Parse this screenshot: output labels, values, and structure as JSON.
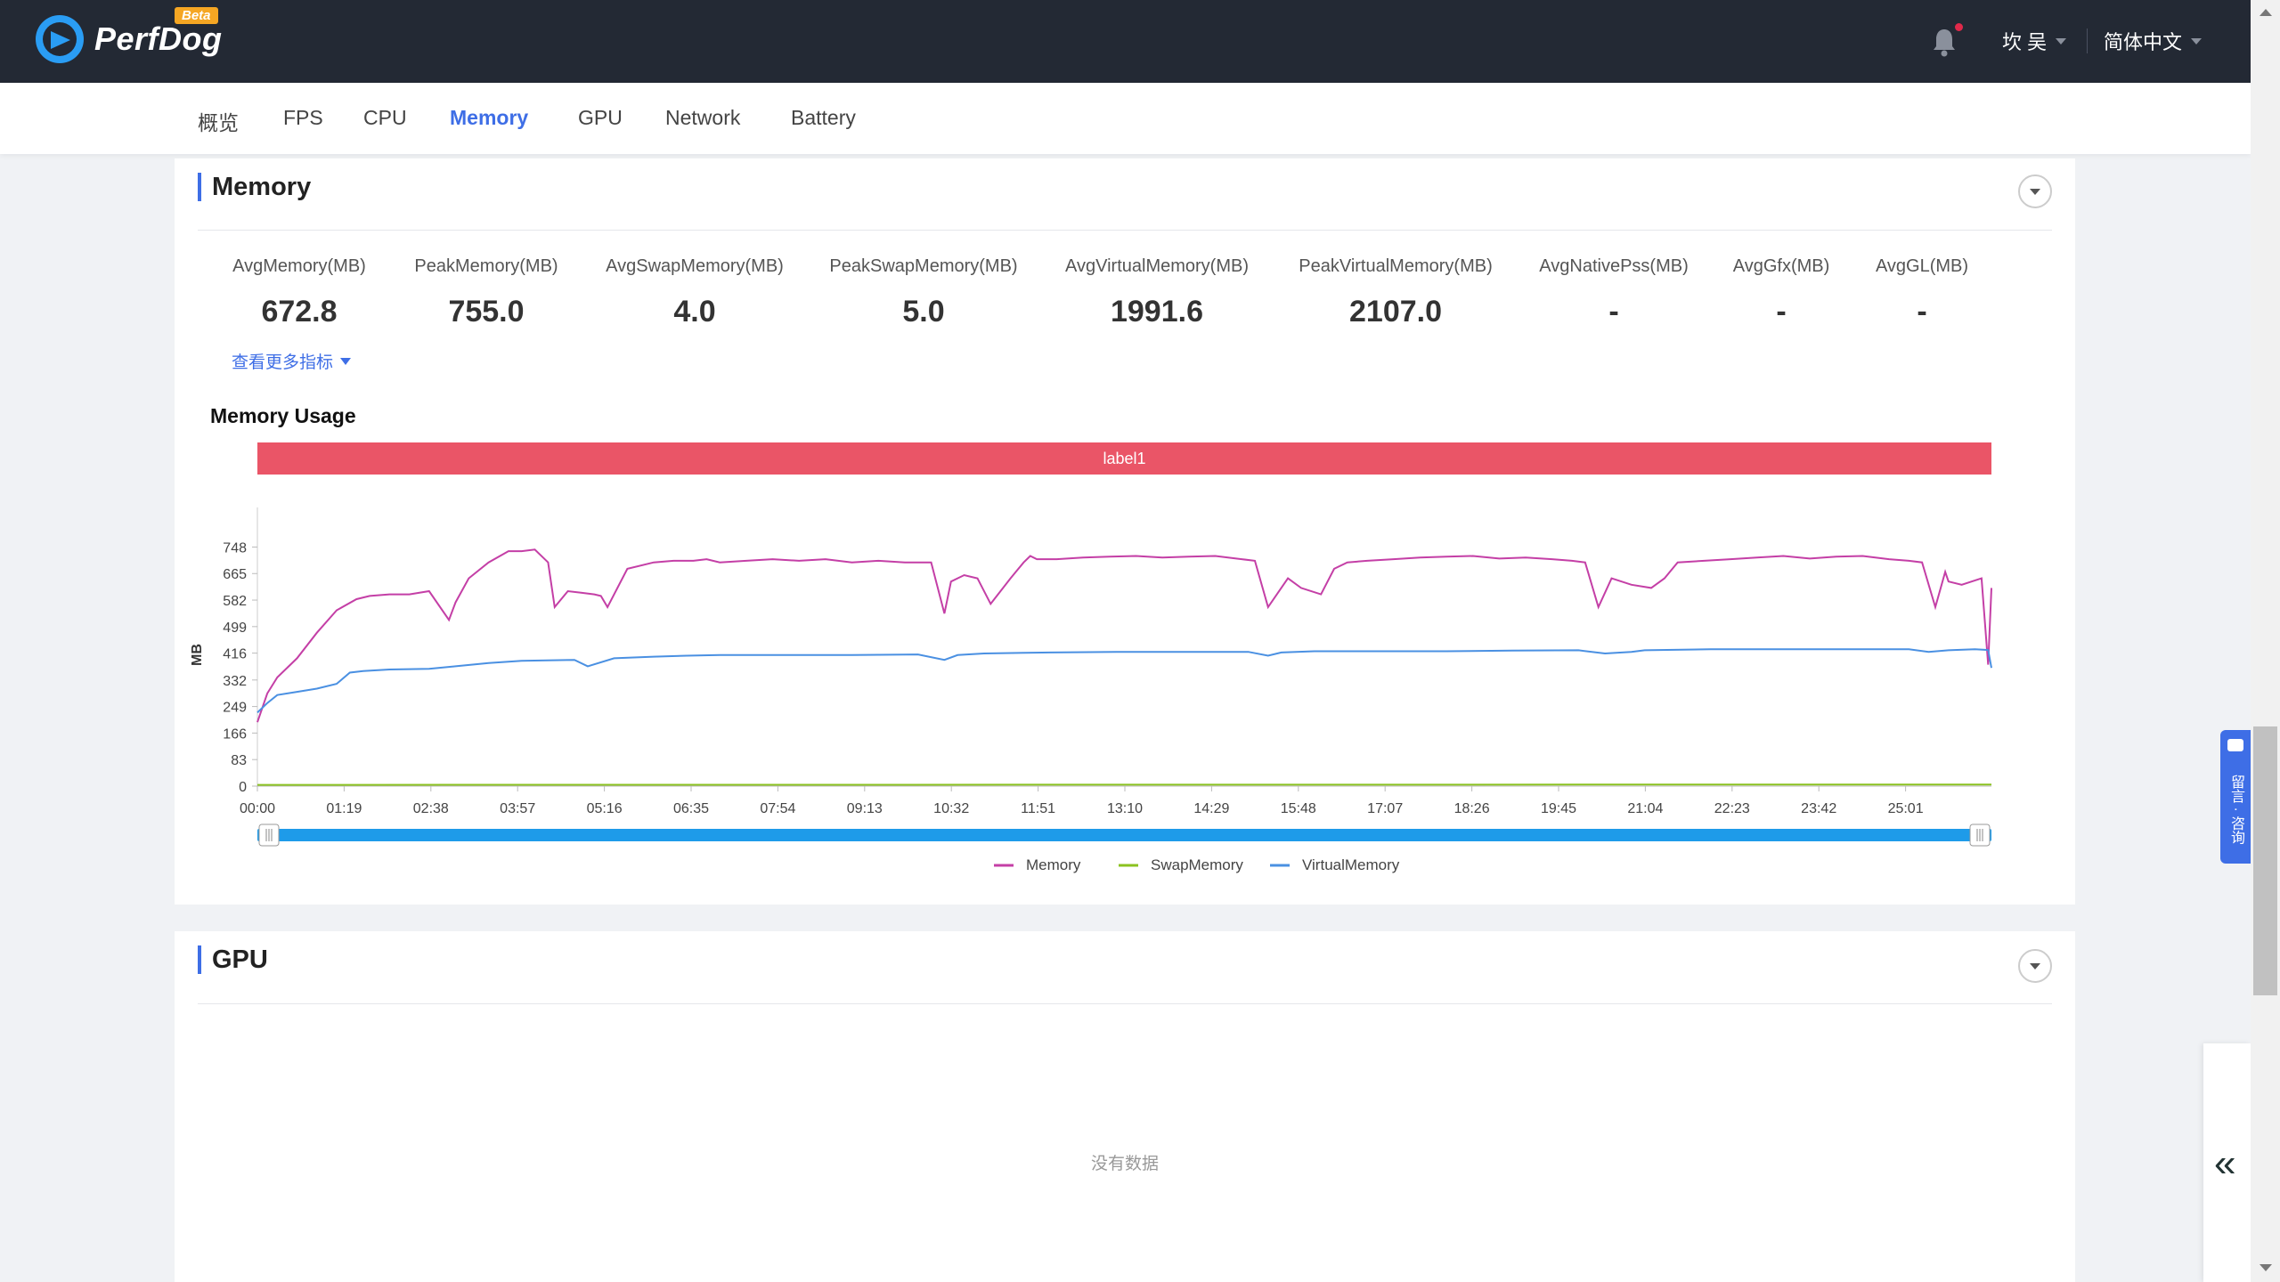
{
  "header": {
    "brand": "PerfDog",
    "badge": "Beta",
    "user": "坎 吴",
    "language": "简体中文"
  },
  "tabs": [
    {
      "label": "概览"
    },
    {
      "label": "FPS"
    },
    {
      "label": "CPU"
    },
    {
      "label": "Memory",
      "active": true
    },
    {
      "label": "GPU"
    },
    {
      "label": "Network"
    },
    {
      "label": "Battery"
    }
  ],
  "memory_panel": {
    "title": "Memory",
    "metrics": [
      {
        "label": "AvgMemory(MB)",
        "value": "672.8"
      },
      {
        "label": "PeakMemory(MB)",
        "value": "755.0"
      },
      {
        "label": "AvgSwapMemory(MB)",
        "value": "4.0"
      },
      {
        "label": "PeakSwapMemory(MB)",
        "value": "5.0"
      },
      {
        "label": "AvgVirtualMemory(MB)",
        "value": "1991.6"
      },
      {
        "label": "PeakVirtualMemory(MB)",
        "value": "2107.0"
      },
      {
        "label": "AvgNativePss(MB)",
        "value": "-"
      },
      {
        "label": "AvgGfx(MB)",
        "value": "-"
      },
      {
        "label": "AvgGL(MB)",
        "value": "-"
      }
    ],
    "more_metrics_link": "查看更多指标",
    "chart_title": "Memory Usage"
  },
  "gpu_panel": {
    "title": "GPU",
    "empty_text": "没有数据"
  },
  "feedback_tab": "留言 · 咨询",
  "colors": {
    "accent": "#3e6ee6",
    "memory": "#c43fa6",
    "swap": "#8bc220",
    "virtual": "#4a90e2",
    "label_band": "#ea5567",
    "slider": "#1e9be9"
  },
  "chart_data": {
    "type": "line",
    "ylabel": "MB",
    "yticks": [
      0,
      83,
      166,
      249,
      332,
      416,
      499,
      582,
      665,
      748
    ],
    "ylim": [
      0,
      830
    ],
    "xticks": [
      "00:00",
      "01:19",
      "02:38",
      "03:57",
      "05:16",
      "06:35",
      "07:54",
      "09:13",
      "10:32",
      "11:51",
      "13:10",
      "14:29",
      "15:48",
      "17:07",
      "18:26",
      "19:45",
      "21:04",
      "22:23",
      "23:42",
      "25:01"
    ],
    "label_band": "label1",
    "series": [
      {
        "name": "Memory",
        "x_min": [
          0,
          0.15,
          0.3,
          0.6,
          0.9,
          1.2,
          1.5,
          1.7,
          2.0,
          2.3,
          2.6,
          2.9,
          3.0,
          3.2,
          3.5,
          3.8,
          3.9,
          4.0,
          4.2,
          4.4,
          4.5,
          4.7,
          4.9,
          5.1,
          5.2,
          5.3,
          5.6,
          6.0,
          6.3,
          6.6,
          6.8,
          7.0,
          7.4,
          7.8,
          8.2,
          8.6,
          9.0,
          9.4,
          9.8,
          10.2,
          10.4,
          10.5,
          10.7,
          10.9,
          11.1,
          11.4,
          11.6,
          11.7,
          11.8,
          12.1,
          12.5,
          12.9,
          13.3,
          13.7,
          14.1,
          14.5,
          14.9,
          15.1,
          15.3,
          15.6,
          15.8,
          16.1,
          16.3,
          16.5,
          16.8,
          17.2,
          17.6,
          18.0,
          18.4,
          18.8,
          19.2,
          19.6,
          19.9,
          20.1,
          20.3,
          20.5,
          20.8,
          21.1,
          21.3,
          21.5,
          21.9,
          22.3,
          22.7,
          23.1,
          23.5,
          23.9,
          24.3,
          24.7,
          25.0,
          25.2,
          25.4,
          25.55,
          25.6,
          25.8,
          26.1,
          26.2,
          26.25
        ],
        "values": [
          200,
          290,
          340,
          400,
          480,
          550,
          585,
          595,
          600,
          600,
          610,
          520,
          575,
          650,
          700,
          735,
          735,
          735,
          740,
          700,
          560,
          610,
          605,
          600,
          595,
          560,
          680,
          700,
          705,
          705,
          710,
          700,
          705,
          710,
          705,
          710,
          700,
          705,
          700,
          700,
          540,
          640,
          660,
          650,
          570,
          650,
          700,
          720,
          710,
          710,
          715,
          718,
          720,
          715,
          718,
          720,
          710,
          705,
          560,
          650,
          620,
          600,
          680,
          700,
          705,
          710,
          715,
          718,
          720,
          712,
          715,
          710,
          705,
          700,
          560,
          650,
          630,
          620,
          650,
          700,
          705,
          710,
          715,
          720,
          712,
          718,
          720,
          710,
          705,
          700,
          560,
          670,
          640,
          630,
          650,
          380,
          620
        ]
      },
      {
        "name": "SwapMemory",
        "x_min": [
          0,
          26.25
        ],
        "values": [
          4,
          5
        ]
      },
      {
        "name": "VirtualMemory",
        "x_min": [
          0,
          0.15,
          0.3,
          0.6,
          0.9,
          1.2,
          1.4,
          1.6,
          2.0,
          2.6,
          3.0,
          3.5,
          4.0,
          4.8,
          5.0,
          5.4,
          6.0,
          6.5,
          7.0,
          8.0,
          9.0,
          10.0,
          10.4,
          10.6,
          11.0,
          12.0,
          13.0,
          14.0,
          15.0,
          15.3,
          15.5,
          16.0,
          17.0,
          18.0,
          19.0,
          20.0,
          20.4,
          20.8,
          21.0,
          22.0,
          23.0,
          24.0,
          25.0,
          25.3,
          25.6,
          26.0,
          26.2,
          26.25
        ],
        "values": [
          230,
          260,
          285,
          295,
          305,
          320,
          355,
          360,
          365,
          367,
          375,
          385,
          392,
          395,
          375,
          400,
          405,
          408,
          410,
          410,
          410,
          412,
          395,
          410,
          415,
          418,
          420,
          420,
          420,
          408,
          418,
          422,
          422,
          422,
          424,
          425,
          415,
          420,
          425,
          428,
          428,
          428,
          428,
          420,
          425,
          428,
          426,
          370
        ]
      }
    ]
  }
}
